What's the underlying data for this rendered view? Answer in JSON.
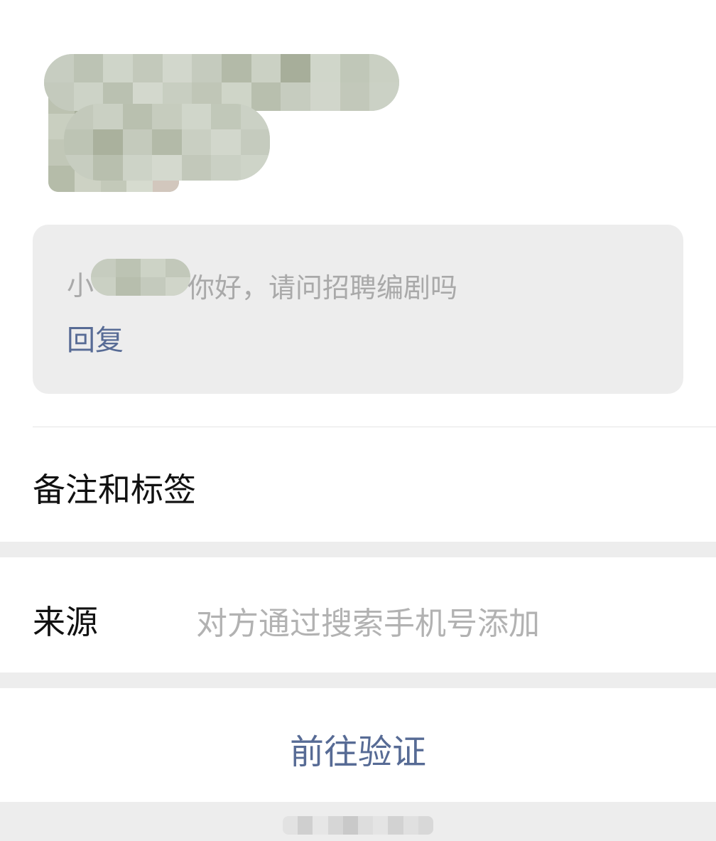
{
  "profile": {
    "name_visible_fragment": "小",
    "avatar_icon": "avatar-photo-pixelated"
  },
  "greeting": {
    "sender_fragment": "小",
    "message": "你好，请问招聘编剧吗",
    "reply_label": "回复"
  },
  "notes_row": {
    "label": "备注和标签"
  },
  "source_row": {
    "label": "来源",
    "value": "对方通过搜索手机号添加"
  },
  "verify_row": {
    "label": "前往验证"
  },
  "colors": {
    "link": "#576b95",
    "primary_text": "#111111",
    "secondary_text": "#b2b2b2",
    "section_bg": "#ededed",
    "card_bg": "#ededed"
  }
}
